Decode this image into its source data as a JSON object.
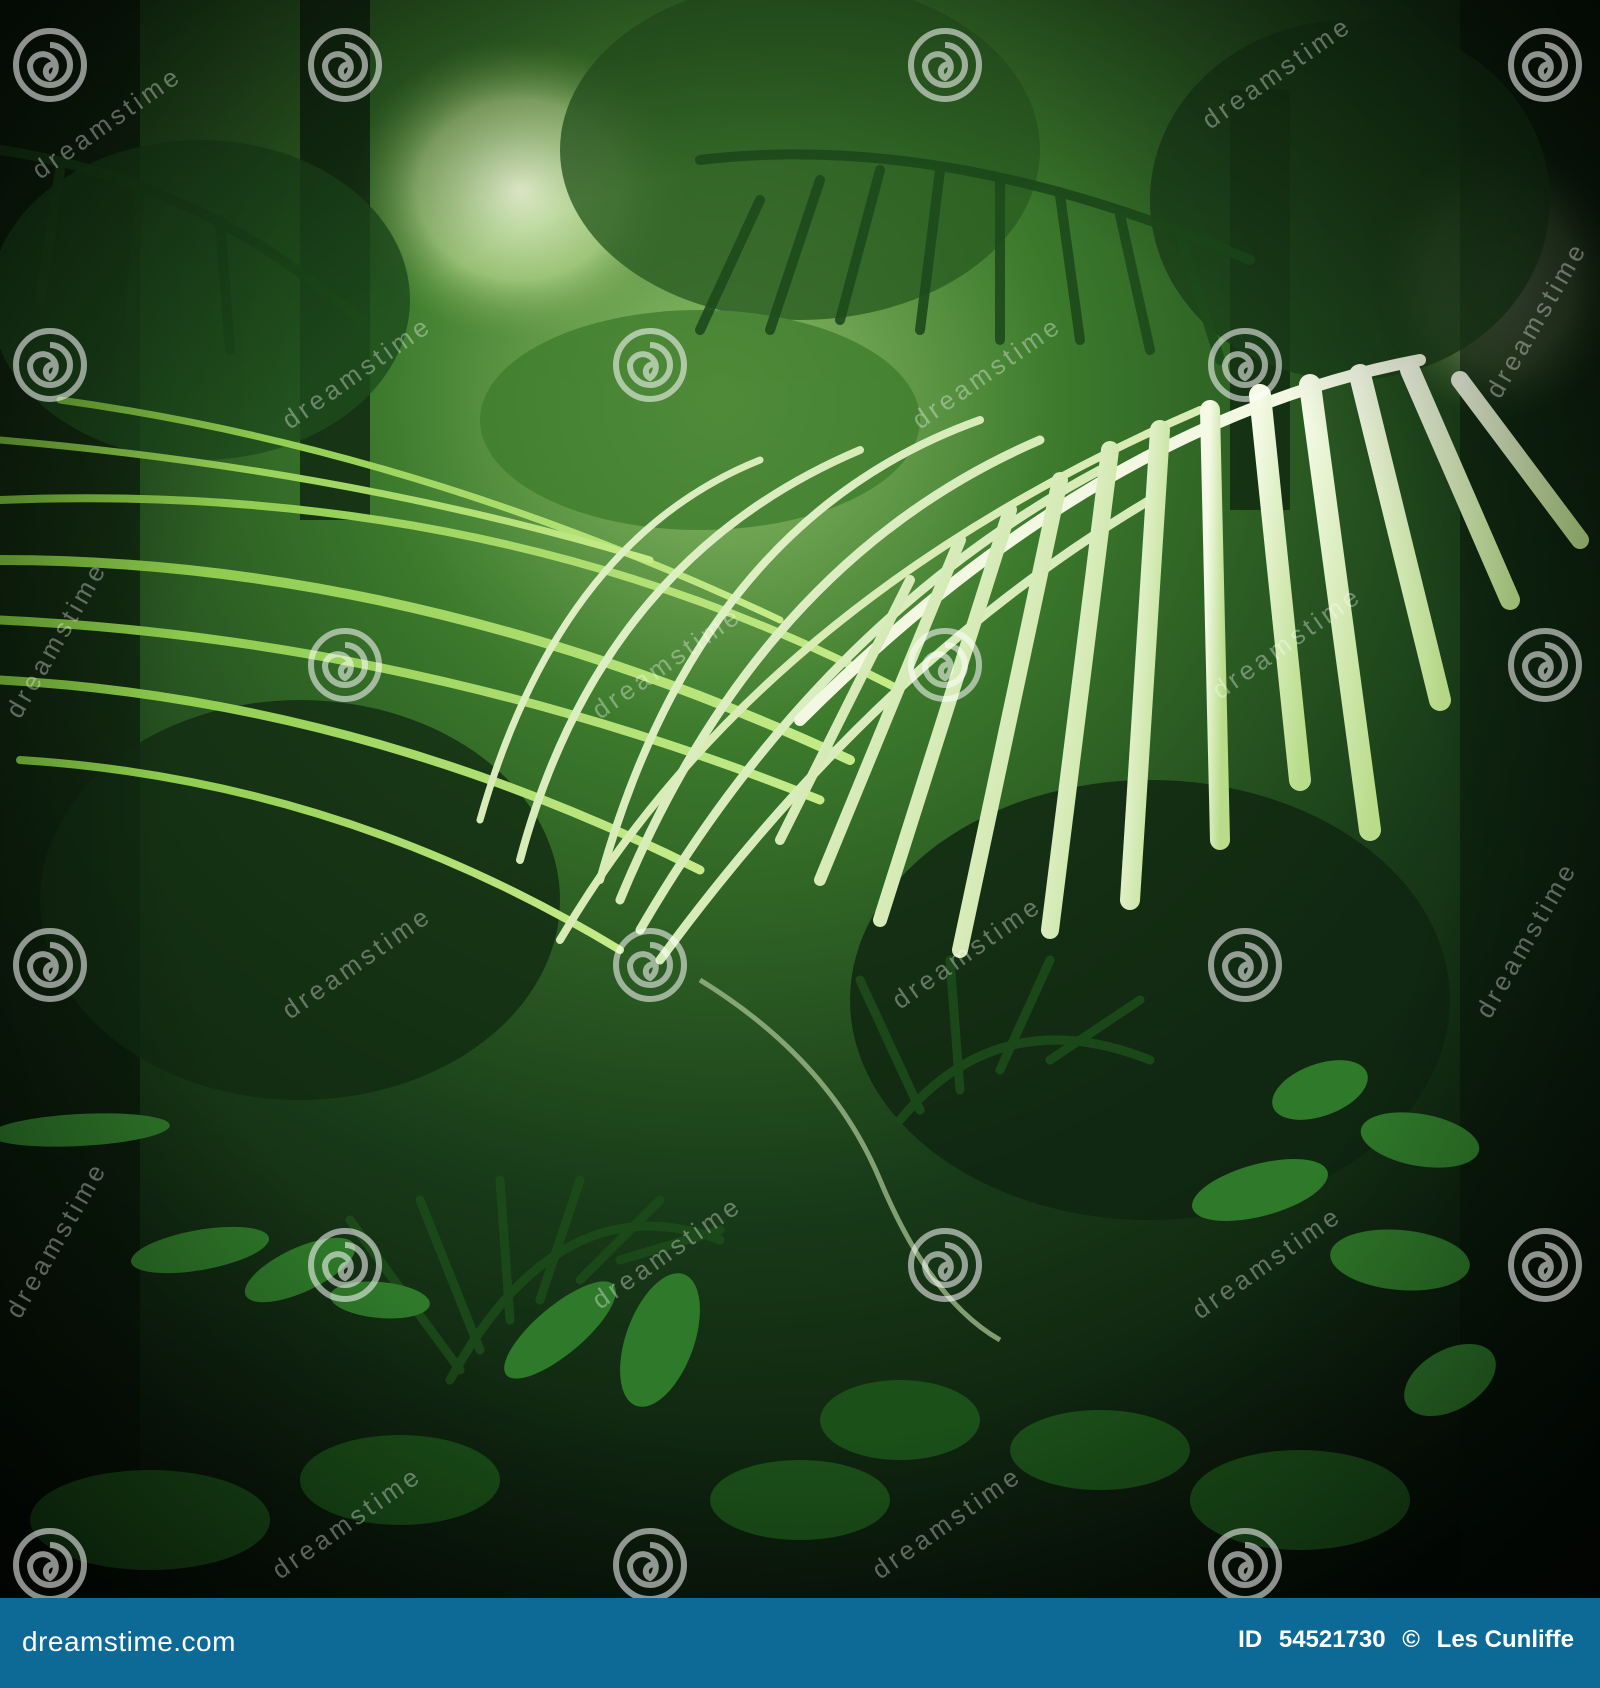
{
  "image": {
    "subject": "jungle palm fronds",
    "dominant_colors": [
      "#0b1a0c",
      "#1f4a1e",
      "#3e8a2a",
      "#a8d86a",
      "#eef6da"
    ],
    "watermark_text": "dreamstime",
    "watermark_icon": "spiral-logo-icon"
  },
  "footer": {
    "site": "dreamstime.com",
    "id_label": "ID",
    "id_number": "54521730",
    "copyright_symbol": "©",
    "author": "Les Cunliffe",
    "background_color": "#0d6a96"
  }
}
